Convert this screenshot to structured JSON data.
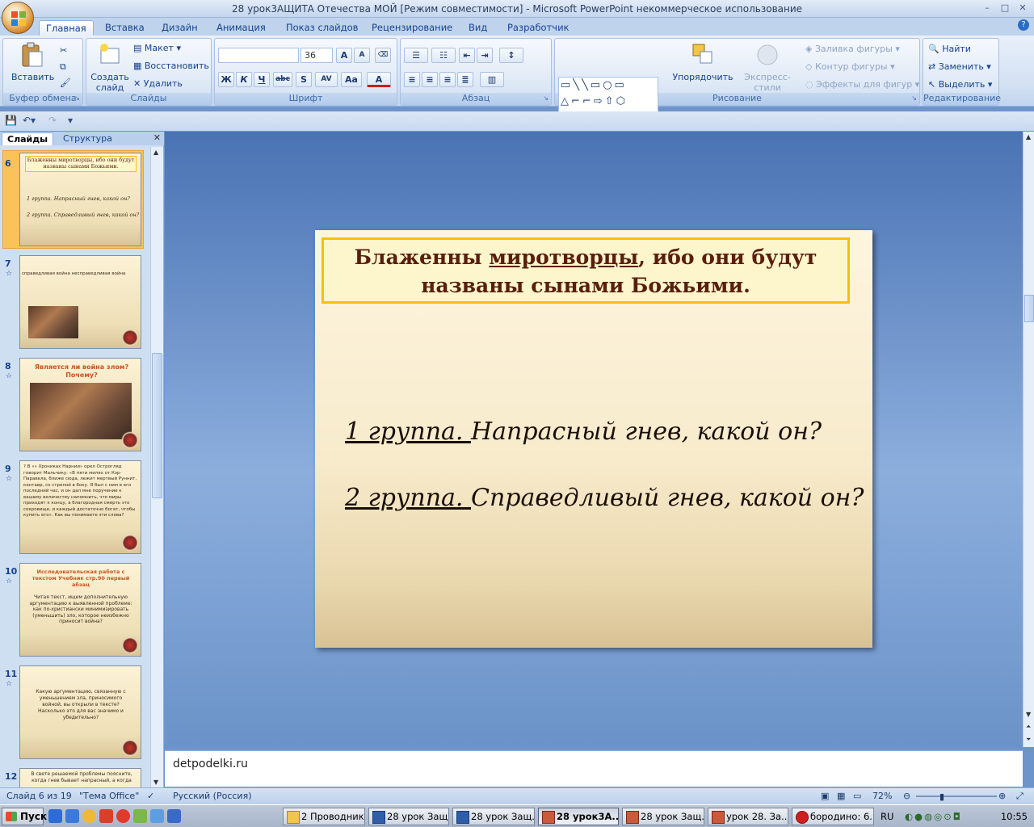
{
  "window": {
    "title": "28 урок3АЩИТА Отечества МОЙ [Режим совместимости] - Microsoft PowerPoint некоммерческое использование",
    "controls": [
      "–",
      "□",
      "✕"
    ]
  },
  "ribbon_tabs": [
    "Главная",
    "Вставка",
    "Дизайн",
    "Анимация",
    "Показ слайдов",
    "Рецензирование",
    "Вид",
    "Разработчик"
  ],
  "groups": {
    "clipboard": {
      "label": "Буфер обмена",
      "paste": "Вставить"
    },
    "slides": {
      "label": "Слайды",
      "new_slide_1": "Создать",
      "new_slide_2": "слайд",
      "layout": "Макет",
      "reset": "Восстановить",
      "delete": "Удалить"
    },
    "font": {
      "label": "Шрифт",
      "font_name": "",
      "font_size": "36"
    },
    "paragraph": {
      "label": "Абзац"
    },
    "drawing": {
      "label": "Рисование",
      "arrange": "Упорядочить",
      "quick_styles": "Экспресс-стили",
      "fill": "Заливка фигуры",
      "outline": "Контур фигуры",
      "effects": "Эффекты для фигур"
    },
    "editing": {
      "label": "Редактирование",
      "find": "Найти",
      "replace": "Заменить",
      "select": "Выделить"
    }
  },
  "pane": {
    "tab_slides": "Слайды",
    "tab_outline": "Структура"
  },
  "thumbs": [
    {
      "num": "6",
      "title": "Блаженны миротворцы, ибо они будут названы сынами Божьими.",
      "line1": "1 группа. Напрасный гнев, какой он?",
      "line2": "2 группа. Справедливый гнев, какой он?"
    },
    {
      "num": "7",
      "text": "справедливая война     несправедливая война"
    },
    {
      "num": "8",
      "text": "Является ли война злом? Почему?"
    },
    {
      "num": "9",
      "text": "? В «» Хрониках Нарнии» орел Острогляд говорит Мальчику: «В пяти милях от Кэр-Паравела, ближе сюда, лежит мертвый Руннит, кентавр, со стрелой в боку. Я был с ним в его последний час, и он дал мне поручение к вашему величеству напомнить, что миры приходят к концу, а благородная смерть это сокровище, и каждый достаточно богат, чтобы купить его». Как вы понимаете эти слова?"
    },
    {
      "num": "10",
      "text": "Исследовательская работа с текстом Учебник стр.90 первый абзац",
      "text2": "Читая текст, ищем дополнительную аргументацию к выявленной проблеме: как по-христиански минимизировать (уменьшить) зло, которое неизбежно приносит война?"
    },
    {
      "num": "11",
      "text": "Какую аргументацию, связанную с уменьшением зла, приносимого войной, вы открыли в тексте? Насколько это для вас значимо и убедительно?"
    },
    {
      "num": "12",
      "text": "В свете решаемой проблемы поясните, когда гнев бывает напрасный, а когда"
    }
  ],
  "slide": {
    "title_a": "Блаженны ",
    "title_u": "миротворцы",
    "title_b": ", ибо они будут названы сынами Божьими.",
    "g1_label": "1 группа. ",
    "g1_text": "Напрасный гнев, какой он?",
    "g2_label": "2 группа. ",
    "g2_text": "Справедливый гнев, какой он?"
  },
  "notes": "detpodelki.ru",
  "status": {
    "slide": "Слайд 6 из 19",
    "theme": "\"Тема Office\"",
    "lang": "Русский (Россия)",
    "zoom": "72%"
  },
  "taskbar": {
    "start": "Пуск",
    "buttons": [
      "2 Проводник",
      "28 урок Защ...",
      "28 урок Защ...",
      "28 урок3А...",
      "28 урок Защ...",
      "урок 28. За...",
      "бородино: 6..."
    ],
    "lang": "RU",
    "time": "10:55"
  }
}
